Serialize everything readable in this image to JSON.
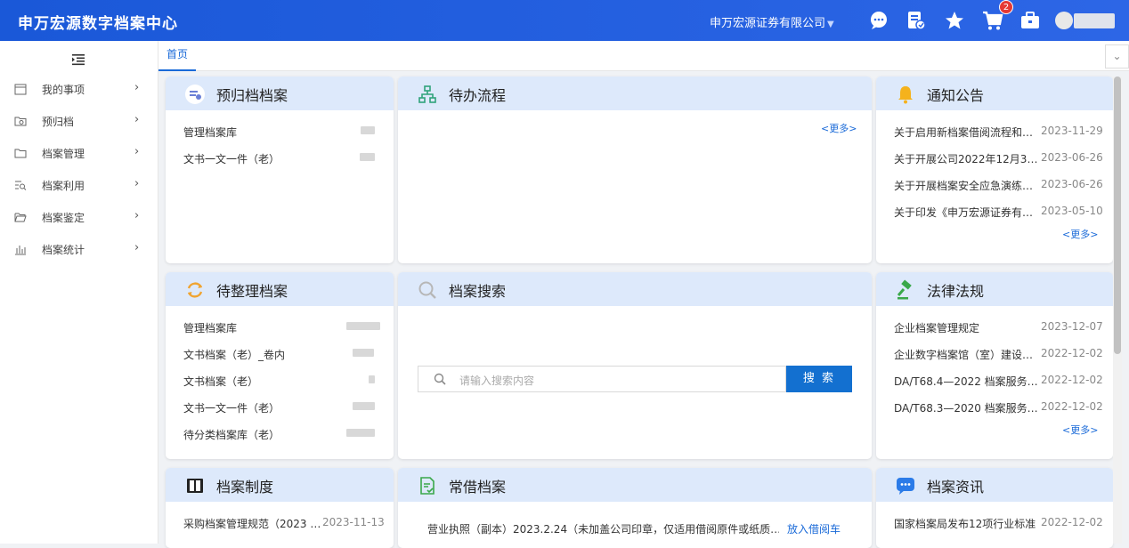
{
  "header": {
    "brand": "申万宏源数字档案中心",
    "company": "申万宏源证券有限公司",
    "cart_badge": "2"
  },
  "sidebar": {
    "items": [
      {
        "label": "我的事项",
        "icon": "calendar-icon"
      },
      {
        "label": "预归档",
        "icon": "folder-sync-icon"
      },
      {
        "label": "档案管理",
        "icon": "folder-icon"
      },
      {
        "label": "档案利用",
        "icon": "list-search-icon"
      },
      {
        "label": "档案鉴定",
        "icon": "folder-open-icon"
      },
      {
        "label": "档案统计",
        "icon": "bar-chart-icon"
      }
    ]
  },
  "tabs": {
    "home": "首页"
  },
  "cards": {
    "pre_archive": {
      "title": "预归档档案",
      "rows": [
        "管理档案库",
        "文书一文一件（老）"
      ]
    },
    "todo": {
      "title": "待办流程",
      "more": "<更多>"
    },
    "notice": {
      "title": "通知公告",
      "more": "<更多>",
      "items": [
        {
          "text": "关于启用新档案借阅流程和…",
          "date": "2023-11-29"
        },
        {
          "text": "关于开展公司2022年12月3…",
          "date": "2023-06-26"
        },
        {
          "text": "关于开展档案安全应急演练…",
          "date": "2023-06-26"
        },
        {
          "text": "关于印发《申万宏源证券有…",
          "date": "2023-05-10"
        }
      ]
    },
    "to_sort": {
      "title": "待整理档案",
      "rows": [
        "管理档案库",
        "文书档案（老）_卷内",
        "文书档案（老）",
        "文书一文一件（老）",
        "待分类档案库（老）"
      ]
    },
    "search": {
      "title": "档案搜索",
      "placeholder": "请输入搜索内容",
      "button": "搜 索"
    },
    "law": {
      "title": "法律法规",
      "more": "<更多>",
      "items": [
        {
          "text": "企业档案管理规定",
          "date": "2023-12-07"
        },
        {
          "text": "企业数字档案馆（室）建设…",
          "date": "2022-12-02"
        },
        {
          "text": "DA/T68.4—2022 档案服务…",
          "date": "2022-12-02"
        },
        {
          "text": "DA/T68.3—2020 档案服务…",
          "date": "2022-12-02"
        }
      ]
    },
    "system": {
      "title": "档案制度",
      "items": [
        {
          "text": "采购档案管理规范（2023 …",
          "date": "2023-11-13"
        }
      ]
    },
    "borrow": {
      "title": "常借档案",
      "items": [
        {
          "text": "营业执照（副本）2023.2.24（未加盖公司印章，仅适用借阅原件或纸质…",
          "action": "放入借阅车"
        }
      ]
    },
    "news": {
      "title": "档案资讯",
      "items": [
        {
          "text": "国家档案局发布12项行业标准",
          "date": "2022-12-02"
        }
      ]
    }
  }
}
